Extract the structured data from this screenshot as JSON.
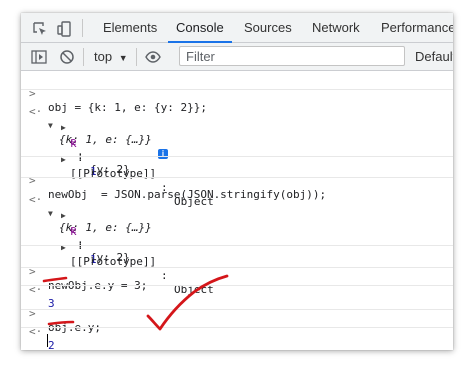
{
  "tabs": [
    {
      "label": "Elements",
      "active": false
    },
    {
      "label": "Console",
      "active": true
    },
    {
      "label": "Sources",
      "active": false
    },
    {
      "label": "Network",
      "active": false
    },
    {
      "label": "Performance",
      "active": false
    }
  ],
  "toolbar": {
    "context": "top",
    "filter_placeholder": "Filter",
    "levels": "Default"
  },
  "console": {
    "prompt": ">",
    "result_marker": "<·",
    "expand": "▶",
    "collapse": "▼",
    "info_badge": "i",
    "entries": [
      {
        "input": "obj = {k: 1, e: {y: 2}};",
        "summary": "{k: 1, e: {…}}",
        "props": [
          {
            "key": "e",
            "sep": ": ",
            "value": "{y: 2}"
          },
          {
            "key": "k",
            "sep": ": ",
            "value": "1"
          },
          {
            "key": "[[Prototype]]",
            "sep": ": ",
            "value": "Object"
          }
        ]
      },
      {
        "input": "newObj  = JSON.parse(JSON.stringify(obj));",
        "summary": "{k: 1, e: {…}}",
        "props": [
          {
            "key": "e",
            "sep": ": ",
            "value": "{y: 2}"
          },
          {
            "key": "k",
            "sep": ": ",
            "value": "1"
          },
          {
            "key": "[[Prototype]]",
            "sep": ": ",
            "value": "Object"
          }
        ]
      },
      {
        "input": "newObj.e.y = 3;",
        "result": "3"
      },
      {
        "input": "obj.e.y;",
        "result": "2"
      }
    ]
  },
  "colors": {
    "annotation": "#d4161a",
    "accent": "#1a73e8",
    "prop_key": "#881391",
    "number": "#1a1aa6"
  }
}
